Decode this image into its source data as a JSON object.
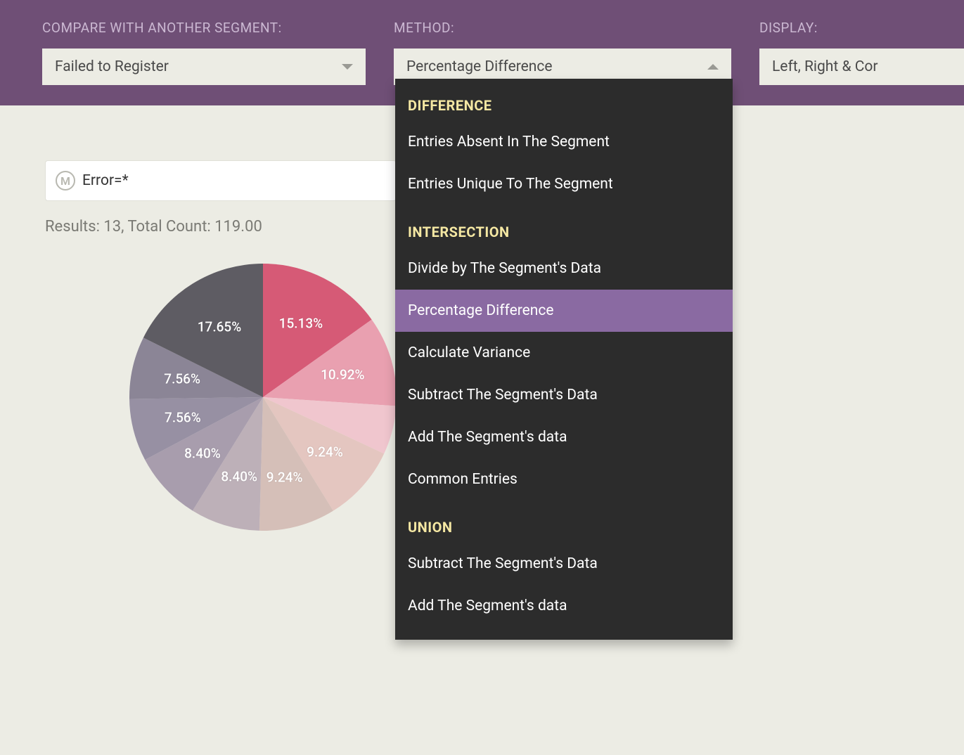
{
  "header": {
    "compare_label": "COMPARE WITH ANOTHER SEGMENT:",
    "compare_value": "Failed to Register",
    "method_label": "METHOD:",
    "method_value": "Percentage Difference",
    "display_label": "DISPLAY:",
    "display_value": "Left, Right & Cor"
  },
  "filter": {
    "badge": "M",
    "text": "Error=*"
  },
  "results_line": "Results: 13, Total Count: 119.00",
  "dropdown": {
    "groups": [
      {
        "title": "DIFFERENCE",
        "items": [
          {
            "label": "Entries Absent In The Segment",
            "selected": false
          },
          {
            "label": "Entries Unique To The Segment",
            "selected": false
          }
        ]
      },
      {
        "title": "INTERSECTION",
        "items": [
          {
            "label": "Divide by The Segment's Data",
            "selected": false
          },
          {
            "label": "Percentage Difference",
            "selected": true
          },
          {
            "label": "Calculate Variance",
            "selected": false
          },
          {
            "label": "Subtract The Segment's Data",
            "selected": false
          },
          {
            "label": "Add The Segment's data",
            "selected": false
          },
          {
            "label": "Common Entries",
            "selected": false
          }
        ]
      },
      {
        "title": "UNION",
        "items": [
          {
            "label": "Subtract The Segment's Data",
            "selected": false
          },
          {
            "label": "Add The Segment's data",
            "selected": false
          }
        ]
      }
    ]
  },
  "chart_data": {
    "type": "pie",
    "title": "",
    "slices": [
      {
        "label": "15.13%",
        "value": 15.13,
        "color": "#d65a76"
      },
      {
        "label": "10.92%",
        "value": 10.92,
        "color": "#e9a0b0"
      },
      {
        "label": "5.90%",
        "value": 5.9,
        "color": "#f0c6ce",
        "hide_label": true
      },
      {
        "label": "9.24%",
        "value": 9.24,
        "color": "#e4c6c0"
      },
      {
        "label": "9.24%",
        "value": 9.24,
        "color": "#d5bfb8"
      },
      {
        "label": "8.40%",
        "value": 8.4,
        "color": "#bdb0b8"
      },
      {
        "label": "8.40%",
        "value": 8.4,
        "color": "#a89dad"
      },
      {
        "label": "7.56%",
        "value": 7.56,
        "color": "#9790a3"
      },
      {
        "label": "7.56%",
        "value": 7.56,
        "color": "#8b8596"
      },
      {
        "label": "17.65%",
        "value": 17.65,
        "color": "#5e5c63"
      }
    ]
  }
}
